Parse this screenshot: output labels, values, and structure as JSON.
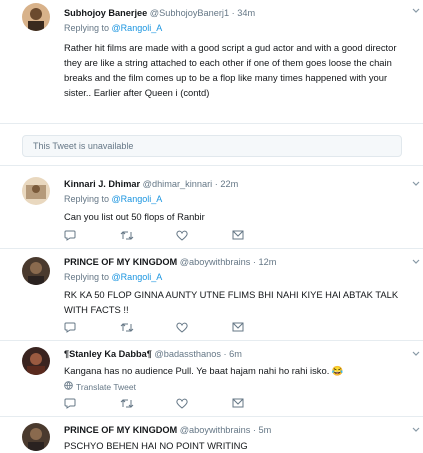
{
  "tweets": [
    {
      "name": "Subhojoy Banerjee",
      "handle": "@SubhojoyBanerj1",
      "dot": "·",
      "time": "34m",
      "reply_prefix": "Replying to",
      "reply_to": "@Rangoli_A",
      "text": "Rather hit films are made with a good script a gud actor and with a good director they are like a string attached to each other if one of them goes loose the chain breaks and the film comes up to be a flop like many times happened with your sister.. Earlier after Queen i (contd)"
    },
    {
      "name": "Kinnari J. Dhimar",
      "handle": "@dhimar_kinnari",
      "dot": "·",
      "time": "22m",
      "reply_prefix": "Replying to",
      "reply_to": "@Rangoli_A",
      "text": "Can you list out 50 flops of Ranbir"
    },
    {
      "name": "PRINCE OF MY KINGDOM",
      "handle": "@aboywithbrains",
      "dot": "·",
      "time": "12m",
      "reply_prefix": "Replying to",
      "reply_to": "@Rangoli_A",
      "text": "RK KA 50 FLOP GINNA AUNTY  UTNE FLIMS BHI NAHI KIYE HAI ABTAK TALK WITH FACTS !!"
    },
    {
      "name": "¶Stanley Ka Dabba¶",
      "handle": "@badassthanos",
      "dot": "·",
      "time": "6m",
      "text": "Kangana has no audience Pull. Ye baat hajam nahi ho rahi isko. 😂",
      "translate": "Translate Tweet"
    },
    {
      "name": "PRINCE OF MY KINGDOM",
      "handle": "@aboywithbrains",
      "dot": "·",
      "time": "5m",
      "text": "PSCHYO BEHEN HAI  NO POINT WRITING"
    }
  ],
  "unavailable": "This Tweet is unavailable",
  "icons": {
    "reply": "reply-icon",
    "retweet": "retweet-icon",
    "like": "heart-icon",
    "dm": "envelope-icon",
    "more": "chevron-down-icon"
  },
  "colors": {
    "link": "#1b95e0",
    "secondary": "#657786",
    "border": "#e6ecf0"
  }
}
